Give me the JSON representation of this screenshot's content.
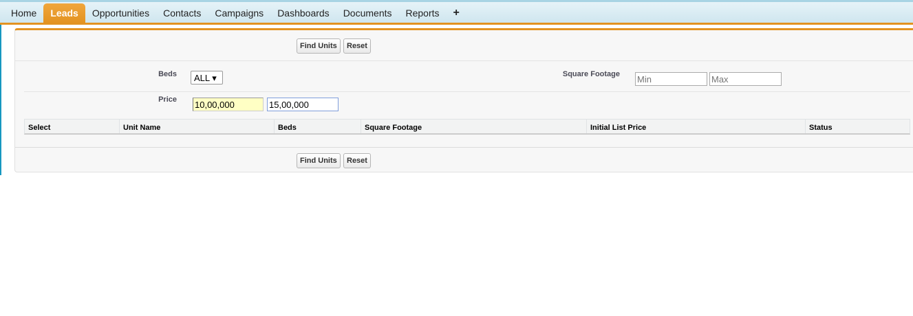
{
  "tabs": [
    {
      "label": "Home"
    },
    {
      "label": "Leads",
      "active": true
    },
    {
      "label": "Opportunities"
    },
    {
      "label": "Contacts"
    },
    {
      "label": "Campaigns"
    },
    {
      "label": "Dashboards"
    },
    {
      "label": "Documents"
    },
    {
      "label": "Reports"
    },
    {
      "label": "+"
    }
  ],
  "buttons": {
    "find": "Find Units",
    "reset": "Reset"
  },
  "filters": {
    "beds_label": "Beds",
    "beds_value": "ALL ▾",
    "sqft_label": "Square Footage",
    "sqft_min_placeholder": "Min",
    "sqft_max_placeholder": "Max",
    "price_label": "Price",
    "price_min": "10,00,000",
    "price_max": "15,00,000"
  },
  "table": {
    "columns": [
      "Select",
      "Unit Name",
      "Beds",
      "Square Footage",
      "Initial List Price",
      "Status"
    ]
  }
}
